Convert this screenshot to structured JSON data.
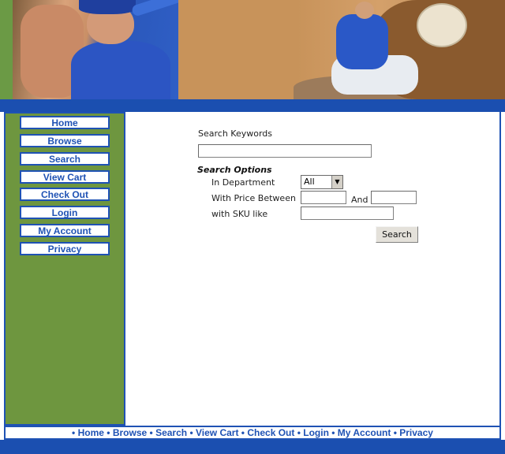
{
  "nav": {
    "items": [
      {
        "label": "Home"
      },
      {
        "label": "Browse"
      },
      {
        "label": "Search"
      },
      {
        "label": "View Cart"
      },
      {
        "label": "Check Out"
      },
      {
        "label": "Login"
      },
      {
        "label": "My Account"
      },
      {
        "label": "Privacy"
      }
    ]
  },
  "search": {
    "keywords_label": "Search Keywords",
    "keywords_value": "",
    "options_heading": "Search Options",
    "department_label": "In Department",
    "department_selected": "All",
    "price_label": "With Price Between",
    "price_min": "",
    "price_and": "And",
    "price_max": "",
    "sku_label": "with SKU like",
    "sku_value": "",
    "submit_label": "Search"
  },
  "footer": {
    "bullet": "•",
    "links": [
      "Home",
      "Browse",
      "Search",
      "View Cart",
      "Check Out",
      "Login",
      "My Account",
      "Privacy"
    ]
  },
  "colors": {
    "brand_blue": "#1f52b4",
    "sidebar_green": "#6e963f"
  },
  "icons": {
    "select_arrow": "dropdown-arrow-icon"
  }
}
